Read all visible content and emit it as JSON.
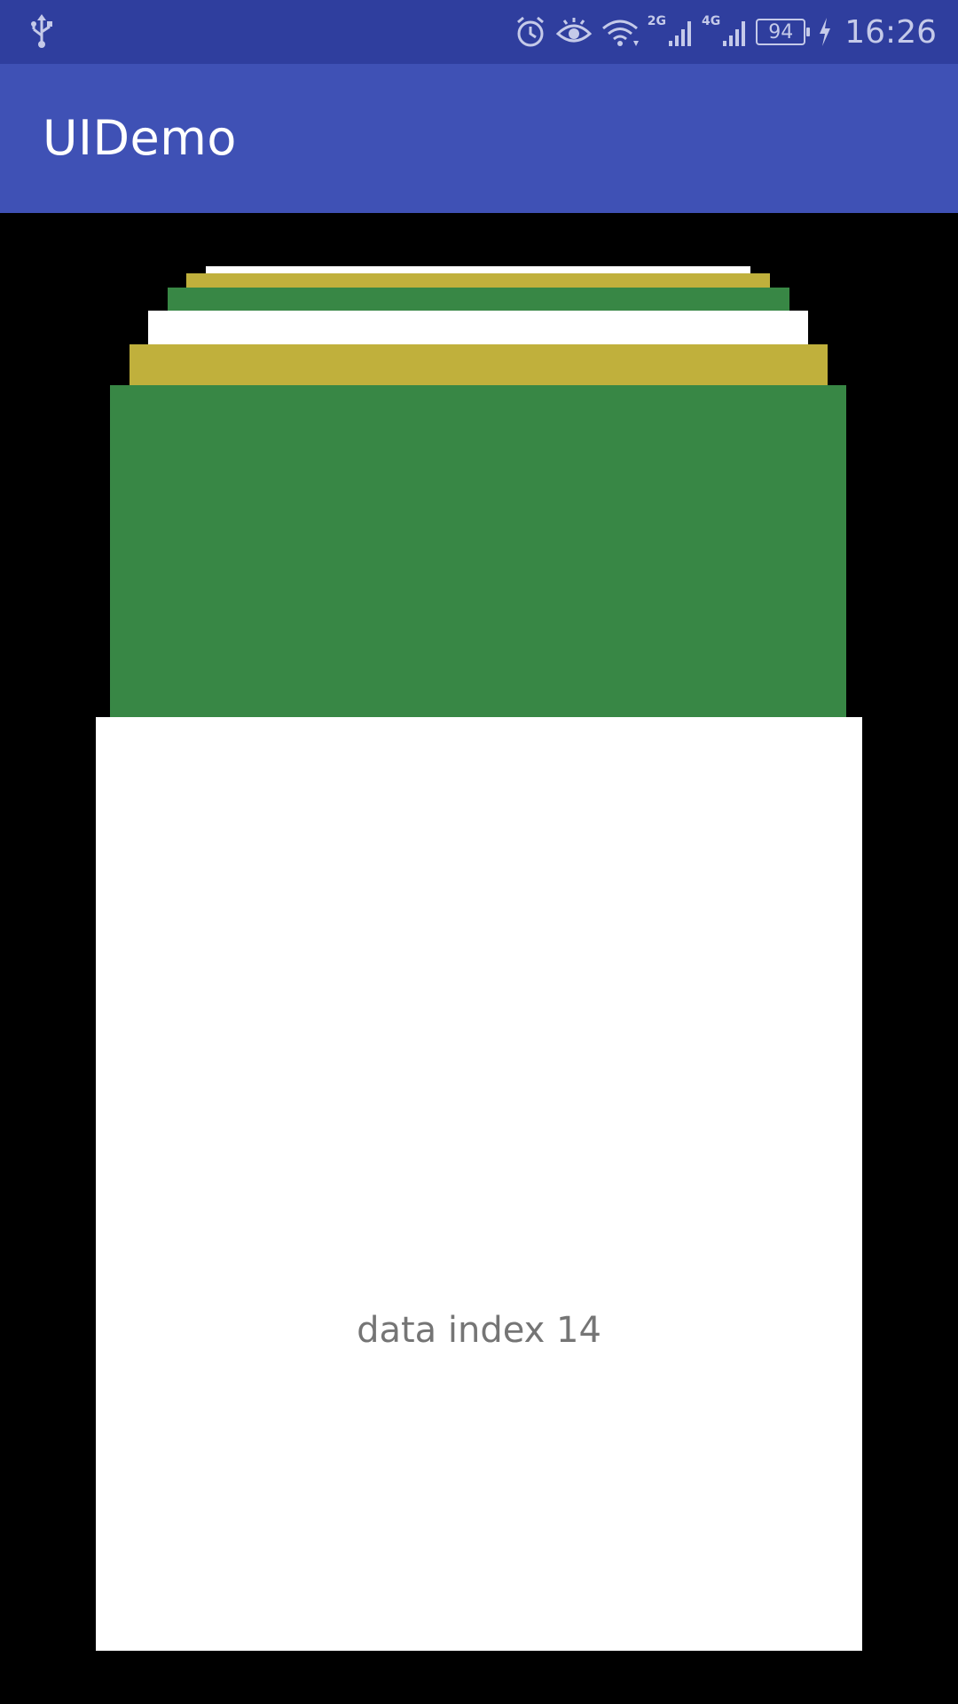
{
  "status_bar": {
    "battery_level": "94",
    "time": "16:26",
    "network_2g": "2G",
    "network_4g": "4G",
    "icons": [
      "usb-icon",
      "alarm-icon",
      "eye-comfort-icon",
      "wifi-icon",
      "signal-2g-icon",
      "signal-4g-icon",
      "battery-icon",
      "charging-icon"
    ]
  },
  "app_bar": {
    "title": "UIDemo",
    "background_color": "#3f51b5"
  },
  "card_stack": {
    "colors": {
      "white": "#ffffff",
      "olive": "#c0b03c",
      "green": "#388745"
    },
    "front_card": {
      "label": "data index 14"
    }
  }
}
